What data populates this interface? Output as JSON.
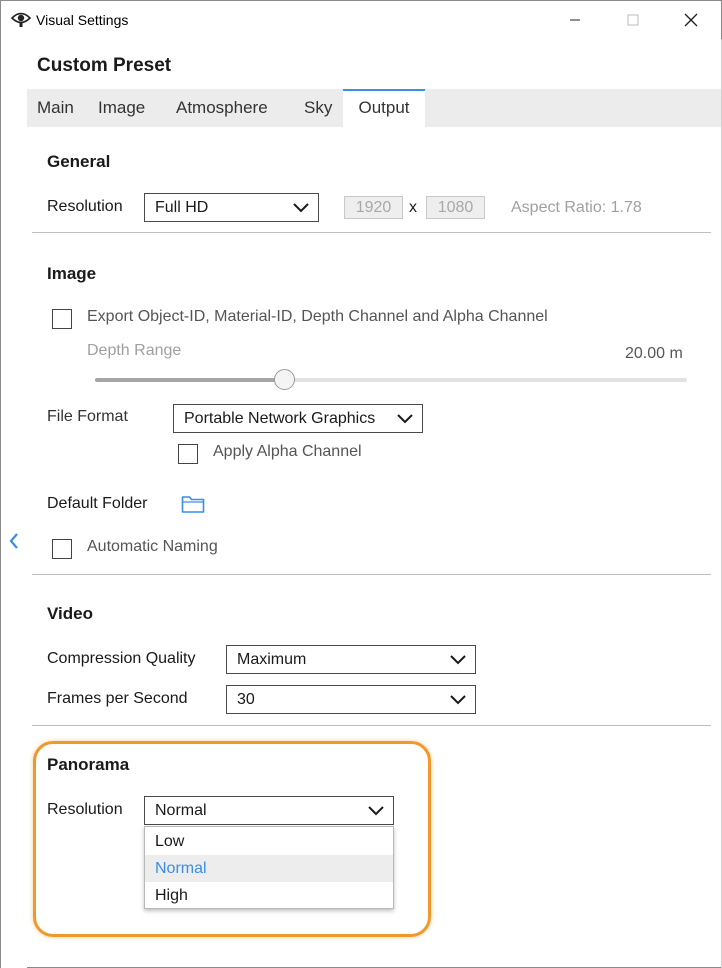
{
  "window": {
    "title": "Visual Settings",
    "icon": "eye-icon"
  },
  "panel": {
    "preset_title": "Custom Preset",
    "tabs": [
      {
        "label": "Main",
        "active": false
      },
      {
        "label": "Image",
        "active": false
      },
      {
        "label": "Atmosphere",
        "active": false
      },
      {
        "label": "Sky",
        "active": false
      },
      {
        "label": "Output",
        "active": true
      }
    ]
  },
  "general": {
    "title": "General",
    "resolution_label": "Resolution",
    "resolution_value": "Full HD",
    "width": "1920",
    "times": "x",
    "height": "1080",
    "aspect_ratio": "Aspect Ratio: 1.78"
  },
  "image": {
    "title": "Image",
    "export_channels_label": "Export Object-ID, Material-ID, Depth Channel and Alpha Channel",
    "export_channels_checked": false,
    "depth_range_label": "Depth Range",
    "depth_range_value": "20.00 m",
    "depth_range_level": 0.32,
    "file_format_label": "File Format",
    "file_format_value": "Portable Network Graphics",
    "apply_alpha_label": "Apply Alpha Channel",
    "apply_alpha_checked": false,
    "default_folder_label": "Default Folder",
    "automatic_naming_label": "Automatic Naming",
    "automatic_naming_checked": false
  },
  "video": {
    "title": "Video",
    "compression_label": "Compression Quality",
    "compression_value": "Maximum",
    "fps_label": "Frames per Second",
    "fps_value": "30"
  },
  "panorama": {
    "title": "Panorama",
    "resolution_label": "Resolution",
    "resolution_value": "Normal",
    "options": [
      {
        "label": "Low",
        "selected": false
      },
      {
        "label": "Normal",
        "selected": true
      },
      {
        "label": "High",
        "selected": false
      }
    ]
  },
  "colors": {
    "accent": "#3a8ee6",
    "highlight": "#f0982b"
  }
}
